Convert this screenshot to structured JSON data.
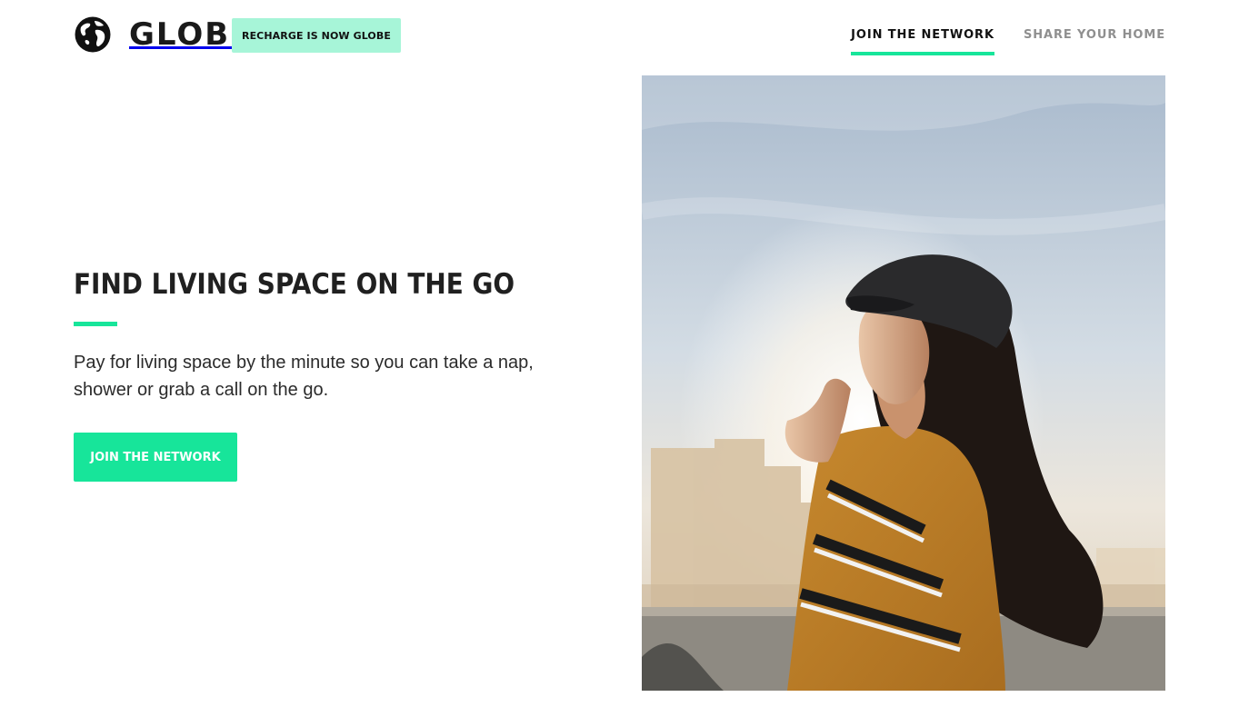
{
  "header": {
    "brand": "GLOBE",
    "logo_icon": "globe-icon",
    "notice": "RECHARGE IS NOW GLOBE",
    "nav": [
      {
        "label": "JOIN THE NETWORK",
        "active": true
      },
      {
        "label": "SHARE YOUR HOME",
        "active": false
      }
    ]
  },
  "hero": {
    "headline": "FIND LIVING SPACE ON THE GO",
    "body": "Pay for living space by the minute so you can take a nap, shower or grab a call on the go.",
    "cta_label": "JOIN THE NETWORK"
  },
  "colors": {
    "accent": "#17e59a",
    "notice_bg": "#a7f5d8",
    "text": "#1e1e1e",
    "nav_muted": "#8f8f8f"
  }
}
